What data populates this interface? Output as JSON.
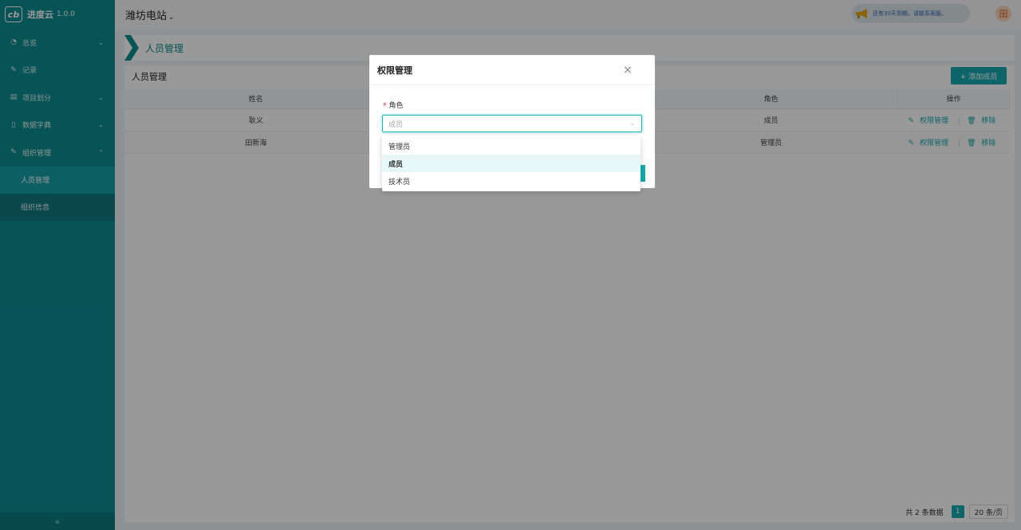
{
  "app": {
    "name": "进度云",
    "version": "1.0.0",
    "logo_glyph": "cb"
  },
  "sidebar": {
    "items": [
      {
        "label": "总览",
        "icon": "◔",
        "icon_name": "dashboard-icon",
        "arrow": "⌄"
      },
      {
        "label": "记录",
        "icon": "✎",
        "icon_name": "edit-icon",
        "arrow": ""
      },
      {
        "label": "项目划分",
        "icon": "▤",
        "icon_name": "list-icon",
        "arrow": "⌄"
      },
      {
        "label": "数据字典",
        "icon": "▯",
        "icon_name": "book-icon",
        "arrow": "⌄"
      },
      {
        "label": "组织管理",
        "icon": "✎",
        "icon_name": "org-icon",
        "arrow": "⌃"
      }
    ],
    "sub_items": [
      {
        "label": "人员管理",
        "active": true
      },
      {
        "label": "组织信息",
        "active": false
      }
    ],
    "collapse_glyph": "«"
  },
  "topbar": {
    "station": "潍坊电站",
    "station_chevron": "⌄",
    "notice": "还有30天到期，请联系客服。",
    "avatar_glyph": "田"
  },
  "page": {
    "title": "人员管理"
  },
  "card": {
    "title": "人员管理",
    "add_button": "+ 添加成员",
    "columns": [
      "姓名",
      "",
      "角色",
      "操作"
    ],
    "rows": [
      {
        "name": "耿义",
        "role": "成员",
        "edit": "权限管理",
        "remove": "移除"
      },
      {
        "name": "田新海",
        "role": "管理员",
        "edit": "权限管理",
        "remove": "移除"
      }
    ],
    "pager": {
      "total": "共 2 条数据",
      "page": "1",
      "size": "20 条/页"
    }
  },
  "modal": {
    "title": "权限管理",
    "close": "×",
    "field_label": "角色",
    "required_mark": "*",
    "select_placeholder": "成员",
    "caret": "⌄",
    "options": [
      {
        "label": "管理员",
        "selected": false
      },
      {
        "label": "成员",
        "selected": true
      },
      {
        "label": "技术员",
        "selected": false
      }
    ]
  },
  "colors": {
    "primary": "#0c8c92",
    "accent": "#17a9b0",
    "required": "#f5222d"
  }
}
